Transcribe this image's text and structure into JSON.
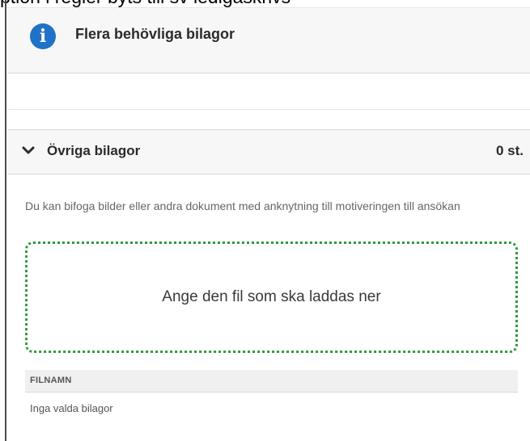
{
  "caption": "ption i regler byts till sv ledigaskrivs",
  "info_panel": {
    "icon": "info-circle-icon",
    "icon_glyph": "i",
    "title": "Flera behövliga bilagor",
    "accent": "#1f72c7"
  },
  "attachments": {
    "chevron_glyph": "❯",
    "title": "Övriga bilagor",
    "count": "0 st.",
    "help_text": "Du kan bifoga bilder eller andra dokument med anknytning till motiveringen till ansökan",
    "dropzone_label": "Ange den fil som ska laddas ner",
    "dropzone_border_color": "#2e9a3a",
    "table": {
      "columns": [
        "FILNAMN"
      ],
      "empty_text": "Inga valda bilagor"
    }
  }
}
